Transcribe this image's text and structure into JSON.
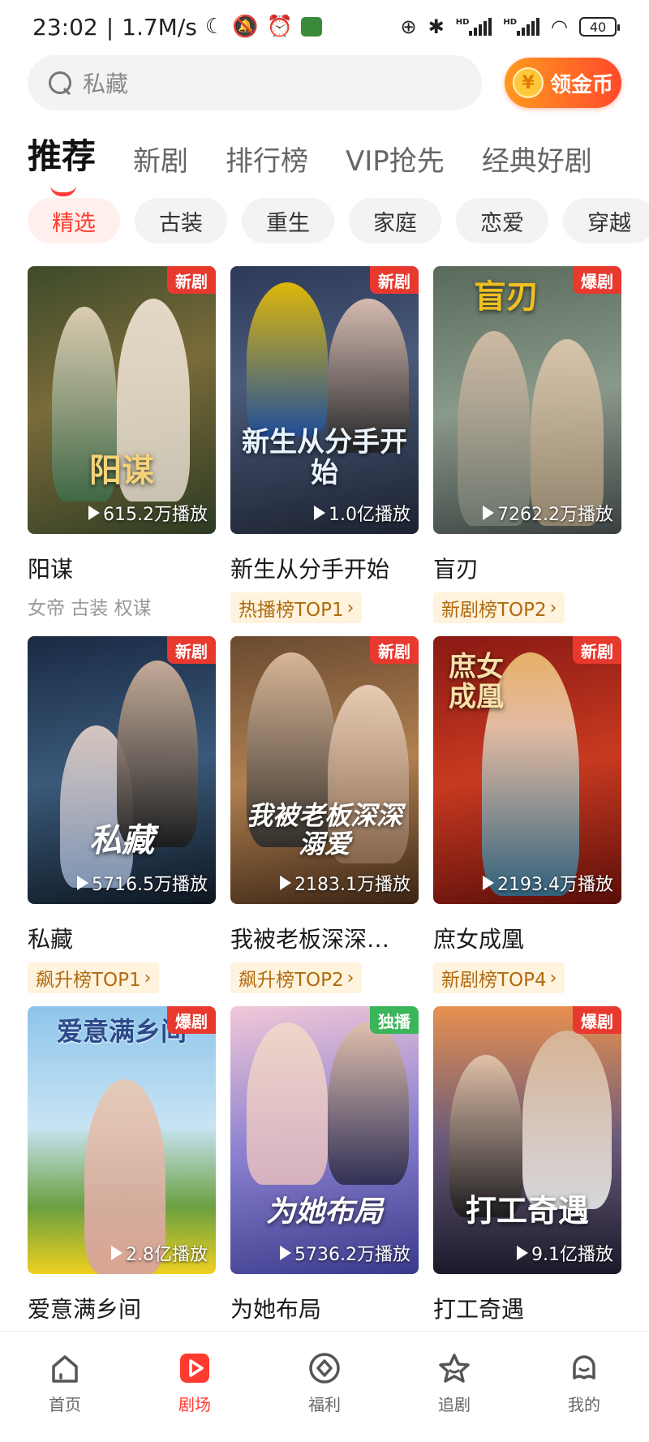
{
  "status_bar": {
    "time": "23:02",
    "speed": "1.7M/s",
    "battery": "40",
    "left_icons": [
      "moon-icon",
      "bell-off-icon",
      "alarm-icon",
      "app-icon"
    ],
    "right_icons": [
      "add-circle-icon",
      "bluetooth-icon",
      "signal-icon",
      "signal-icon",
      "wifi-icon",
      "battery-icon"
    ]
  },
  "search": {
    "placeholder": "私藏",
    "coin_button": "领金币",
    "coin_symbol": "¥"
  },
  "tabs": [
    "推荐",
    "新剧",
    "排行榜",
    "VIP抢先",
    "经典好剧"
  ],
  "chips": [
    "精选",
    "古装",
    "重生",
    "家庭",
    "恋爱",
    "穿越"
  ],
  "dramas": [
    {
      "title": "阳谋",
      "poster_text": "阳谋",
      "badge": "新剧",
      "plays": "615.2万播放",
      "sub": "女帝 古装 权谋",
      "rank": ""
    },
    {
      "title": "新生从分手开始",
      "poster_text": "新生从分手开始",
      "badge": "新剧",
      "plays": "1.0亿播放",
      "sub": "",
      "rank": "热播榜TOP1"
    },
    {
      "title": "盲刃",
      "poster_text": "盲刃",
      "badge": "爆剧",
      "plays": "7262.2万播放",
      "sub": "",
      "rank": "新剧榜TOP2"
    },
    {
      "title": "私藏",
      "poster_text": "私藏",
      "badge": "新剧",
      "plays": "5716.5万播放",
      "sub": "",
      "rank": "飙升榜TOP1"
    },
    {
      "title": "我被老板深深…",
      "poster_text": "我被老板深深溺爱",
      "badge": "新剧",
      "plays": "2183.1万播放",
      "sub": "",
      "rank": "飙升榜TOP2"
    },
    {
      "title": "庶女成凰",
      "poster_text": "庶女成凰",
      "badge": "新剧",
      "plays": "2193.4万播放",
      "sub": "",
      "rank": "新剧榜TOP4"
    },
    {
      "title": "爱意满乡间",
      "poster_text": "爱意满乡间",
      "badge": "爆剧",
      "plays": "2.8亿播放",
      "sub": "",
      "rank": ""
    },
    {
      "title": "为她布局",
      "poster_text": "为她布局",
      "badge": "独播",
      "plays": "5736.2万播放",
      "sub": "",
      "rank": ""
    },
    {
      "title": "打工奇遇",
      "poster_text": "打工奇遇",
      "badge": "爆剧",
      "plays": "9.1亿播放",
      "sub": "",
      "rank": ""
    }
  ],
  "bottom_nav": [
    {
      "label": "首页",
      "icon": "home-icon"
    },
    {
      "label": "剧场",
      "icon": "play-icon"
    },
    {
      "label": "福利",
      "icon": "gift-coin-icon"
    },
    {
      "label": "追剧",
      "icon": "star-icon"
    },
    {
      "label": "我的",
      "icon": "profile-icon"
    }
  ],
  "colors": {
    "accent": "#ff3b30",
    "badge_red": "#e8392f",
    "badge_green": "#3bb55a",
    "rank_bg": "#fff3dd",
    "rank_text": "#b06a10"
  }
}
